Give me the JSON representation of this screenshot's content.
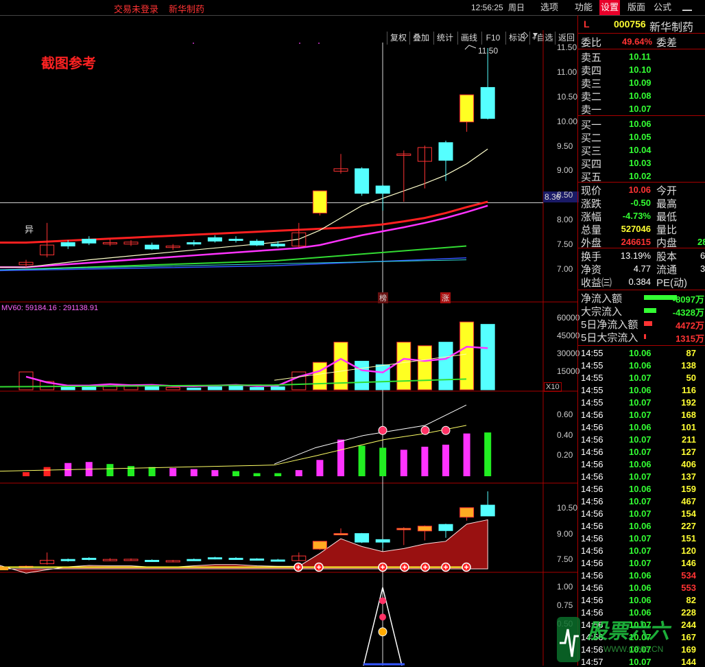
{
  "topbar": {
    "login_link": "交易未登录",
    "stock_link": "新华制药",
    "clock": "12:56:25",
    "weekday": "周日",
    "menus": [
      "选项",
      "功能",
      "设置",
      "版面",
      "公式"
    ],
    "active_menu": "设置"
  },
  "toolbar": {
    "buttons": [
      "复权",
      "叠加",
      "统计",
      "画线",
      "F10",
      "标记",
      "+自选",
      "返回"
    ]
  },
  "chart": {
    "annotation": "截图参考",
    "high_label": "11.50",
    "yi_marker": "异",
    "price_cursor": "8.36",
    "price_ticks": [
      "11.50",
      "11.00",
      "10.50",
      "10.00",
      "9.50",
      "9.00",
      "8.50",
      "8.00",
      "7.50",
      "7.00"
    ],
    "bang_marker": "榜",
    "zhang_marker": "涨",
    "vol_label": "MV60: 59184.16 : 291138.91",
    "vol_ticks": [
      "60000",
      "45000",
      "30000",
      "15000"
    ],
    "vol_unit": "X10",
    "ind_ticks": [
      "0.60",
      "0.40",
      "0.20"
    ],
    "sub_ticks": [
      "10.50",
      "9.00",
      "7.50"
    ],
    "last_ticks": [
      "1.00",
      "0.75",
      "0.50"
    ]
  },
  "chart_data": {
    "type": "candlestick",
    "candles": [
      {
        "o": 7.1,
        "c": 7.15,
        "h": 7.2,
        "l": 7.05
      },
      {
        "o": 7.3,
        "c": 7.5,
        "h": 7.95,
        "l": 7.25
      },
      {
        "o": 7.55,
        "c": 7.48,
        "h": 7.6,
        "l": 7.42
      },
      {
        "o": 7.62,
        "c": 7.54,
        "h": 7.68,
        "l": 7.5
      },
      {
        "o": 7.55,
        "c": 7.55,
        "h": 7.62,
        "l": 7.48
      },
      {
        "o": 7.52,
        "c": 7.56,
        "h": 7.6,
        "l": 7.48
      },
      {
        "o": 7.5,
        "c": 7.42,
        "h": 7.55,
        "l": 7.4
      },
      {
        "o": 7.45,
        "c": 7.48,
        "h": 7.52,
        "l": 7.4
      },
      {
        "o": 7.55,
        "c": 7.52,
        "h": 7.6,
        "l": 7.48
      },
      {
        "o": 7.65,
        "c": 7.58,
        "h": 7.7,
        "l": 7.55
      },
      {
        "o": 7.62,
        "c": 7.6,
        "h": 7.68,
        "l": 7.55
      },
      {
        "o": 7.58,
        "c": 7.5,
        "h": 7.62,
        "l": 7.48
      },
      {
        "o": 7.52,
        "c": 7.48,
        "h": 7.58,
        "l": 7.45
      },
      {
        "o": 7.48,
        "c": 7.75,
        "h": 7.95,
        "l": 7.45
      },
      {
        "o": 8.15,
        "c": 8.6,
        "h": 8.6,
        "l": 8.1
      },
      {
        "o": 9.0,
        "c": 9.05,
        "h": 9.35,
        "l": 8.95
      },
      {
        "o": 9.05,
        "c": 8.55,
        "h": 9.08,
        "l": 8.5
      },
      {
        "o": 8.7,
        "c": 8.55,
        "h": 8.72,
        "l": 8.2
      },
      {
        "o": 9.32,
        "c": 9.35,
        "h": 9.42,
        "l": 8.38
      },
      {
        "o": 9.2,
        "c": 9.48,
        "h": 9.52,
        "l": 8.65
      },
      {
        "o": 9.58,
        "c": 9.22,
        "h": 9.62,
        "l": 8.8
      },
      {
        "o": 10.0,
        "c": 10.55,
        "h": 10.55,
        "l": 9.8
      },
      {
        "o": 10.7,
        "c": 10.07,
        "h": 11.5,
        "l": 10.05
      }
    ],
    "ma_lines": [
      {
        "color": "#ff2020",
        "values": [
          7.55,
          7.57,
          7.59,
          7.61,
          7.63,
          7.65,
          7.67,
          7.69,
          7.71,
          7.73,
          7.75,
          7.77,
          7.79,
          7.81,
          7.83,
          7.85,
          7.88,
          7.92,
          7.98,
          8.05,
          8.15,
          8.27,
          8.38
        ]
      },
      {
        "color": "#ff33ff",
        "values": [
          7.05,
          7.08,
          7.11,
          7.14,
          7.17,
          7.2,
          7.23,
          7.26,
          7.29,
          7.32,
          7.35,
          7.38,
          7.41,
          7.44,
          7.5,
          7.6,
          7.7,
          7.78,
          7.86,
          7.95,
          8.05,
          8.17,
          8.3
        ]
      },
      {
        "color": "#ffffcc",
        "values": [
          7.05,
          7.1,
          7.15,
          7.2,
          7.24,
          7.28,
          7.32,
          7.36,
          7.4,
          7.44,
          7.48,
          7.52,
          7.56,
          7.62,
          7.8,
          8.05,
          8.3,
          8.45,
          8.6,
          8.75,
          8.92,
          9.15,
          9.45
        ]
      }
    ],
    "volume": [
      15000,
      7000,
      2500,
      2500,
      4500,
      3000,
      3500,
      2000,
      1500,
      2500,
      3500,
      2000,
      2500,
      15000,
      23000,
      40000,
      24000,
      21000,
      40000,
      37000,
      40000,
      57000,
      55000
    ],
    "indicator": [
      0.04,
      0.09,
      0.13,
      0.14,
      0.12,
      0.1,
      0.09,
      0.08,
      0.07,
      0.06,
      0.05,
      0.03,
      0.03,
      0.06,
      0.16,
      0.36,
      0.3,
      0.28,
      0.26,
      0.29,
      0.31,
      0.42,
      0.43
    ]
  },
  "quote": {
    "flag": "L",
    "code": "000756",
    "name": "新华制药",
    "weibi_label": "委比",
    "weibi_value": "49.64%",
    "weicha_label": "委差",
    "asks": [
      {
        "label": "卖五",
        "price": "10.11"
      },
      {
        "label": "卖四",
        "price": "10.10"
      },
      {
        "label": "卖三",
        "price": "10.09"
      },
      {
        "label": "卖二",
        "price": "10.08"
      },
      {
        "label": "卖一",
        "price": "10.07"
      }
    ],
    "bids": [
      {
        "label": "买一",
        "price": "10.06"
      },
      {
        "label": "买二",
        "price": "10.05"
      },
      {
        "label": "买三",
        "price": "10.04"
      },
      {
        "label": "买四",
        "price": "10.03"
      },
      {
        "label": "买五",
        "price": "10.02"
      }
    ],
    "stats": [
      {
        "label": "现价",
        "value": "10.06",
        "label2": "今开"
      },
      {
        "label": "涨跌",
        "value": "-0.50",
        "label2": "最高"
      },
      {
        "label": "涨幅",
        "value": "-4.73%",
        "label2": "最低"
      },
      {
        "label": "总量",
        "value": "527046",
        "label2": "量比"
      },
      {
        "label": "外盘",
        "value": "246615",
        "label2": "内盘",
        "extra": "28"
      }
    ],
    "stats2": [
      {
        "label": "换手",
        "value": "13.19%",
        "label2": "股本",
        "extra": "6"
      },
      {
        "label": "净资",
        "value": "4.77",
        "label2": "流通",
        "extra": "3"
      },
      {
        "label": "收益㈢",
        "value": "0.384",
        "label2": "PE(动)"
      }
    ],
    "flows": [
      {
        "label": "净流入额",
        "value": "-8097万"
      },
      {
        "label": "大宗流入",
        "value": "-4328万"
      },
      {
        "label": "5日净流入额",
        "value": "4472万"
      },
      {
        "label": "5日大宗流入",
        "value": "1315万"
      }
    ],
    "ticks": [
      {
        "t": "14:55",
        "p": "10.06",
        "v": "87"
      },
      {
        "t": "14:55",
        "p": "10.06",
        "v": "138"
      },
      {
        "t": "14:55",
        "p": "10.07",
        "v": "50"
      },
      {
        "t": "14:55",
        "p": "10.06",
        "v": "116"
      },
      {
        "t": "14:55",
        "p": "10.07",
        "v": "192"
      },
      {
        "t": "14:56",
        "p": "10.07",
        "v": "168"
      },
      {
        "t": "14:56",
        "p": "10.06",
        "v": "101"
      },
      {
        "t": "14:56",
        "p": "10.07",
        "v": "211"
      },
      {
        "t": "14:56",
        "p": "10.07",
        "v": "127"
      },
      {
        "t": "14:56",
        "p": "10.06",
        "v": "406"
      },
      {
        "t": "14:56",
        "p": "10.07",
        "v": "137"
      },
      {
        "t": "14:56",
        "p": "10.06",
        "v": "159"
      },
      {
        "t": "14:56",
        "p": "10.07",
        "v": "467"
      },
      {
        "t": "14:56",
        "p": "10.07",
        "v": "154"
      },
      {
        "t": "14:56",
        "p": "10.06",
        "v": "227"
      },
      {
        "t": "14:56",
        "p": "10.07",
        "v": "151"
      },
      {
        "t": "14:56",
        "p": "10.07",
        "v": "120"
      },
      {
        "t": "14:56",
        "p": "10.07",
        "v": "146"
      },
      {
        "t": "14:56",
        "p": "10.06",
        "v": "534"
      },
      {
        "t": "14:56",
        "p": "10.06",
        "v": "553"
      },
      {
        "t": "14:56",
        "p": "10.06",
        "v": "82"
      },
      {
        "t": "14:56",
        "p": "10.06",
        "v": "228"
      },
      {
        "t": "14:56",
        "p": "10.07",
        "v": "244"
      },
      {
        "t": "14:56",
        "p": "10.07",
        "v": "167"
      },
      {
        "t": "14:56",
        "p": "10.07",
        "v": "169"
      },
      {
        "t": "14:57",
        "p": "10.07",
        "v": "144"
      }
    ]
  },
  "watermark": {
    "main": "股票六六",
    "sub": "WWW.CP66.CN"
  }
}
